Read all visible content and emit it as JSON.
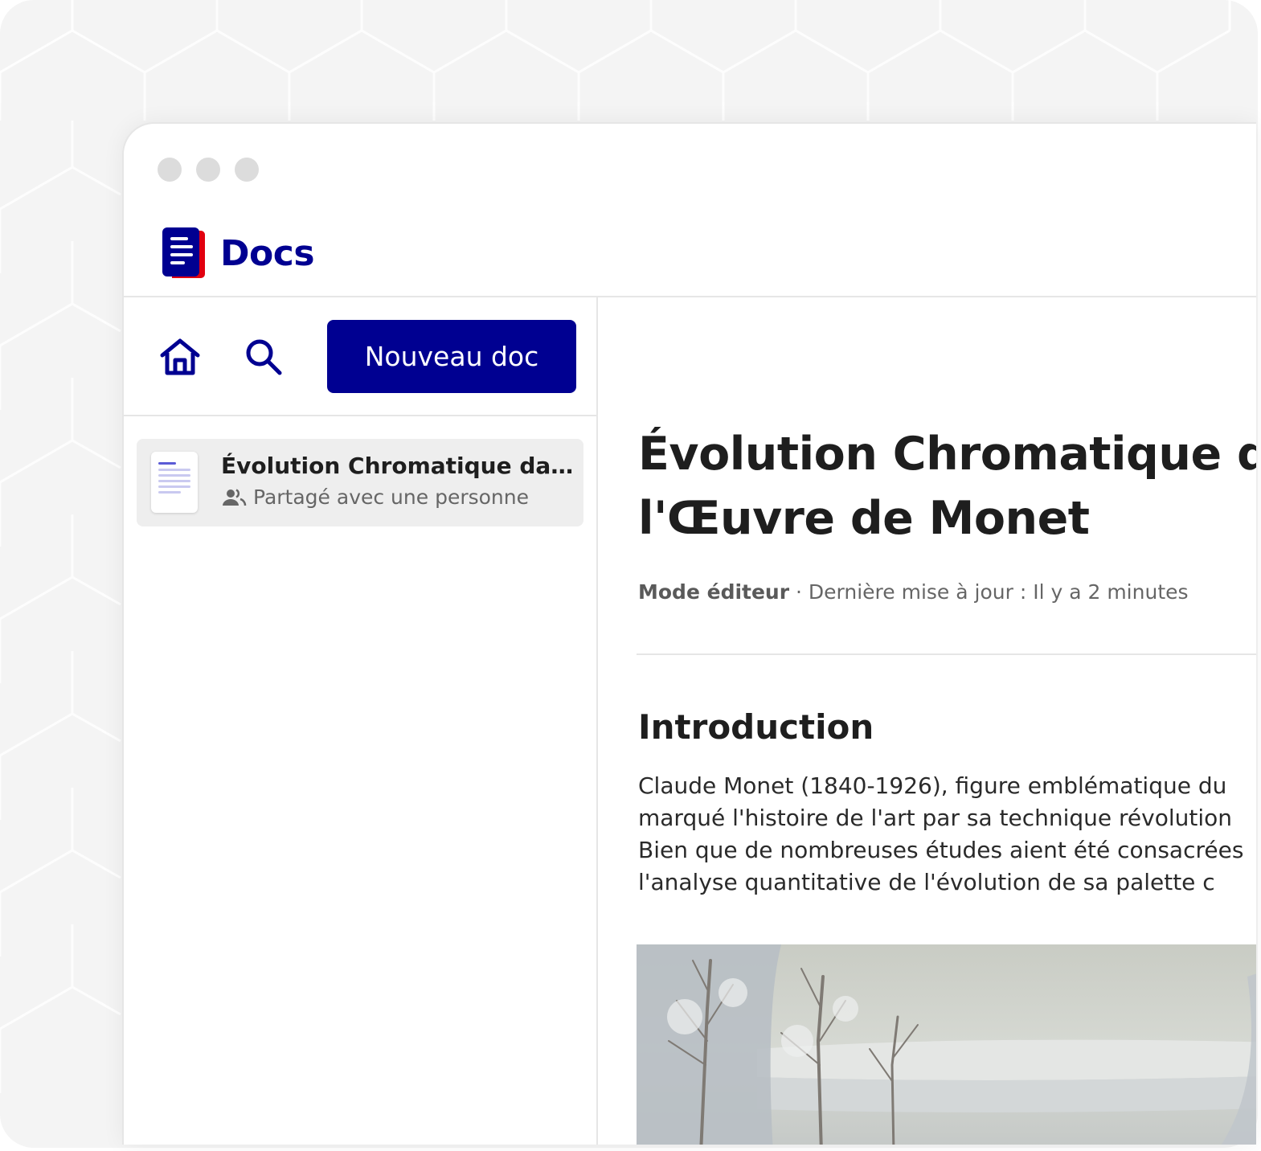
{
  "app": {
    "title": "Docs",
    "brand_color": "#000091",
    "accent_red": "#e1000f"
  },
  "toolbar": {
    "home_icon": "home-icon",
    "search_icon": "search-icon",
    "new_doc_label": "Nouveau doc"
  },
  "sidebar": {
    "documents": [
      {
        "title": "Évolution Chromatique dans l'Œuvre de Monet",
        "shared_label": "Partagé avec une personne",
        "shared_icon": "people-icon"
      }
    ]
  },
  "document": {
    "title_line1": "Évolution Chromatique dans",
    "title_line2": "l'Œuvre de Monet",
    "mode": "Mode éditeur",
    "separator": " · ",
    "last_update": "Dernière mise à jour : Il y a 2 minutes",
    "section_title": "Introduction",
    "paragraph_lines": [
      "Claude Monet (1840-1926), figure emblématique du",
      "marqué l'histoire de l'art par sa technique révolution",
      "Bien que de nombreuses études aient été consacrées",
      "l'analyse quantitative de l'évolution de sa palette c"
    ],
    "image_icon": "winter-landscape-painting"
  }
}
